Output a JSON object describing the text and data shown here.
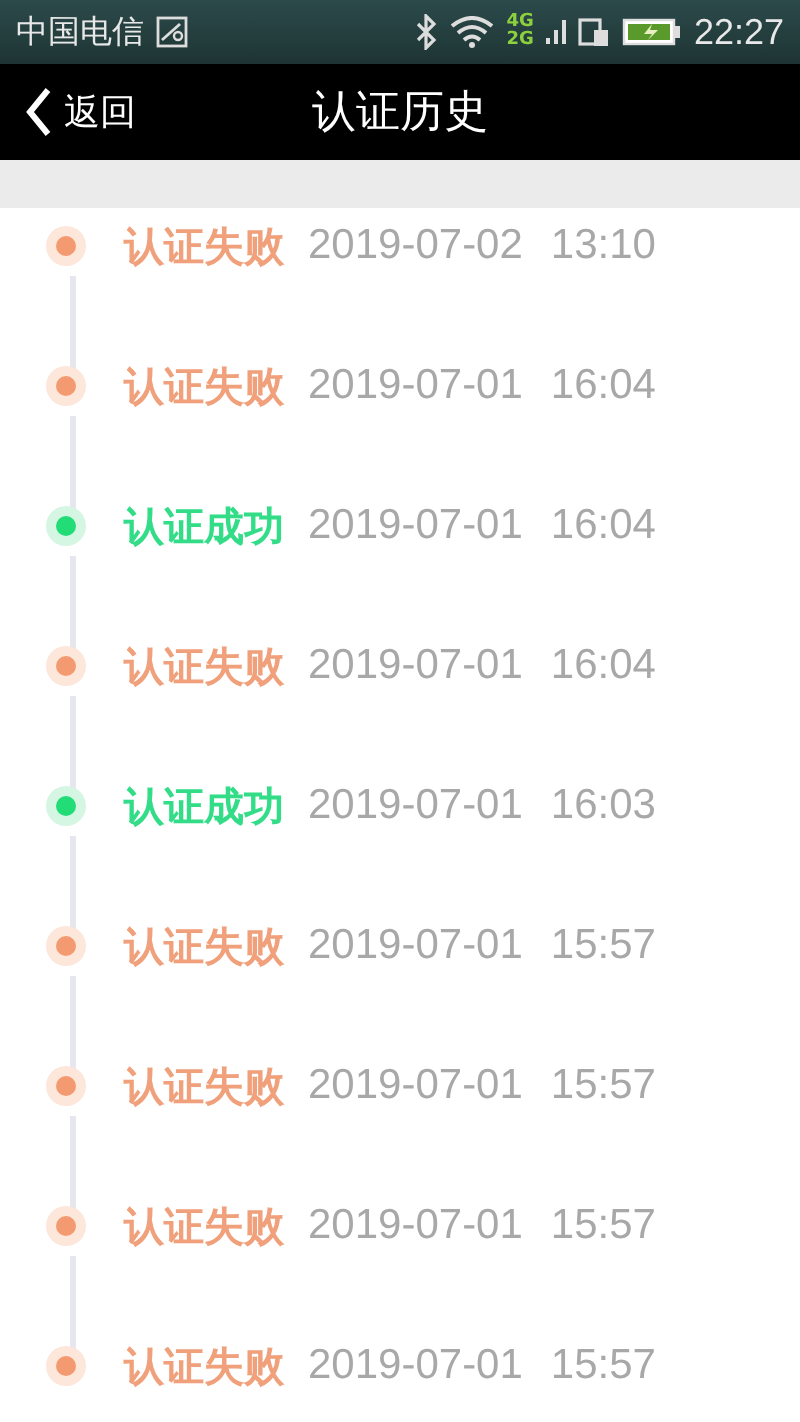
{
  "status_bar": {
    "carrier": "中国电信",
    "network_top": "4G",
    "network_bottom": "2G",
    "time": "22:27"
  },
  "header": {
    "back": "返回",
    "title": "认证历史"
  },
  "records": [
    {
      "kind": "fail",
      "status": "认证失败",
      "date": "2019-07-02",
      "time": "13:10"
    },
    {
      "kind": "fail",
      "status": "认证失败",
      "date": "2019-07-01",
      "time": "16:04"
    },
    {
      "kind": "success",
      "status": "认证成功",
      "date": "2019-07-01",
      "time": "16:04"
    },
    {
      "kind": "fail",
      "status": "认证失败",
      "date": "2019-07-01",
      "time": "16:04"
    },
    {
      "kind": "success",
      "status": "认证成功",
      "date": "2019-07-01",
      "time": "16:03"
    },
    {
      "kind": "fail",
      "status": "认证失败",
      "date": "2019-07-01",
      "time": "15:57"
    },
    {
      "kind": "fail",
      "status": "认证失败",
      "date": "2019-07-01",
      "time": "15:57"
    },
    {
      "kind": "fail",
      "status": "认证失败",
      "date": "2019-07-01",
      "time": "15:57"
    },
    {
      "kind": "fail",
      "status": "认证失败",
      "date": "2019-07-01",
      "time": "15:57"
    }
  ]
}
